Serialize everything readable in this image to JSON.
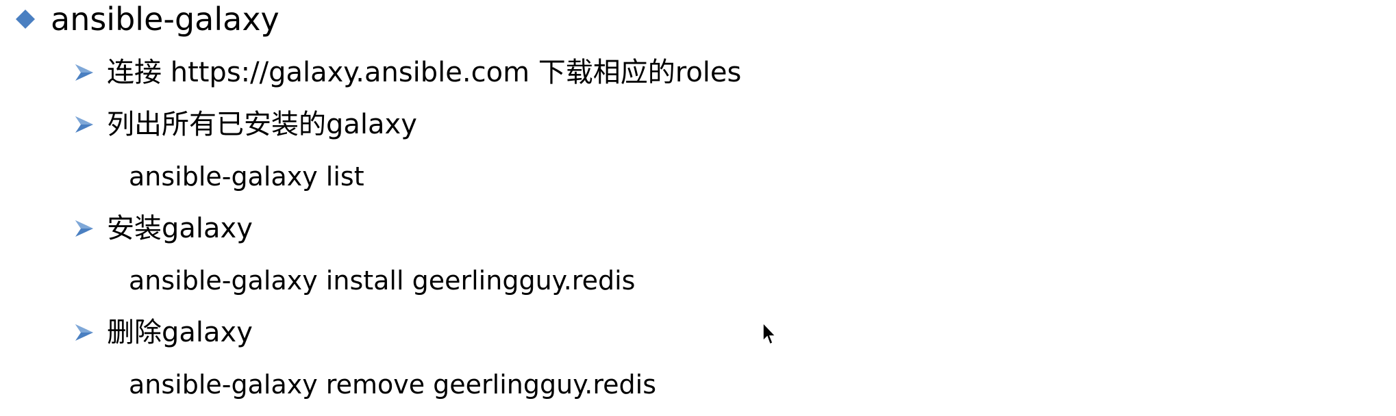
{
  "heading": {
    "icon": "diamond-bullet-icon",
    "icon_color": "#4A7FC1",
    "text": "ansible-galaxy"
  },
  "items": [
    {
      "icon": "arrow-bullet-icon",
      "text": "连接 https://galaxy.ansible.com 下载相应的roles"
    },
    {
      "icon": "arrow-bullet-icon",
      "text": "列出所有已安装的galaxy",
      "command": "ansible-galaxy list"
    },
    {
      "icon": "arrow-bullet-icon",
      "text": "安装galaxy",
      "command": "ansible-galaxy install geerlingguy.redis"
    },
    {
      "icon": "arrow-bullet-icon",
      "text": "删除galaxy",
      "command": "ansible-galaxy remove geerlingguy.redis"
    }
  ],
  "arrow_color": "#4A7FC1",
  "cursor": {
    "icon": "mouse-pointer-icon"
  }
}
